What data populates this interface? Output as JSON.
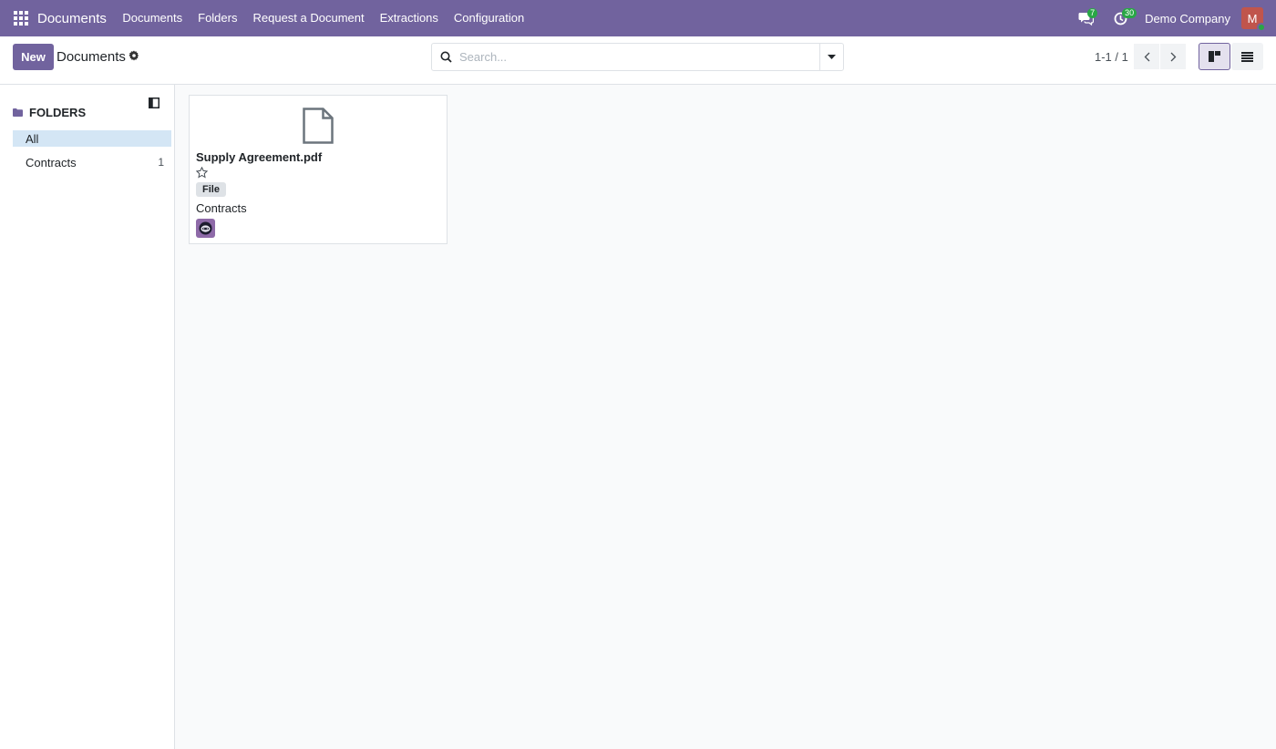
{
  "navbar": {
    "brand": "Documents",
    "menu": [
      "Documents",
      "Folders",
      "Request a Document",
      "Extractions",
      "Configuration"
    ],
    "messages_count": "7",
    "activities_count": "30",
    "company": "Demo Company",
    "avatar_letter": "M"
  },
  "control": {
    "new_label": "New",
    "title": "Documents",
    "search_placeholder": "Search...",
    "pager": "1-1 / 1"
  },
  "sidebar": {
    "header": "FOLDERS",
    "items": [
      {
        "label": "All",
        "count": ""
      },
      {
        "label": "Contracts",
        "count": "1"
      }
    ]
  },
  "card": {
    "name": "Supply Agreement.pdf",
    "tag": "File",
    "folder": "Contracts"
  },
  "colors": {
    "brand": "#71639e",
    "active_folder": "#d4e6f5"
  }
}
